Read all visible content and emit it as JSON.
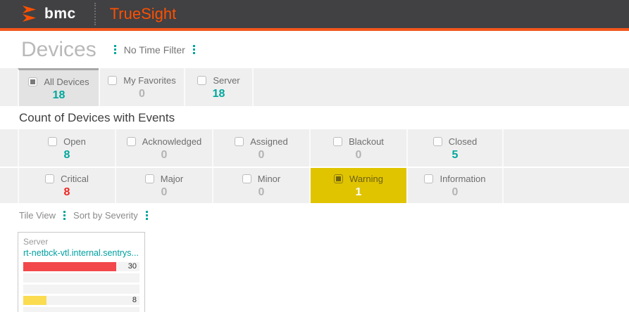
{
  "header": {
    "brand": "bmc",
    "product": "TrueSight"
  },
  "page": {
    "title": "Devices",
    "time_filter_label": "No Time Filter"
  },
  "device_tabs": [
    {
      "label": "All Devices",
      "count": "18",
      "selected": true,
      "count_style": "accent"
    },
    {
      "label": "My Favorites",
      "count": "0",
      "selected": false,
      "count_style": "zero"
    },
    {
      "label": "Server",
      "count": "18",
      "selected": false,
      "count_style": "accent"
    }
  ],
  "events": {
    "heading": "Count of Devices with Events",
    "status_filters": [
      {
        "label": "Open",
        "count": "8",
        "count_style": "accent"
      },
      {
        "label": "Acknowledged",
        "count": "0",
        "count_style": "zero"
      },
      {
        "label": "Assigned",
        "count": "0",
        "count_style": "zero"
      },
      {
        "label": "Blackout",
        "count": "0",
        "count_style": "zero"
      },
      {
        "label": "Closed",
        "count": "5",
        "count_style": "accent"
      }
    ],
    "severity_filters": [
      {
        "label": "Critical",
        "count": "8",
        "count_style": "critical",
        "selected": false
      },
      {
        "label": "Major",
        "count": "0",
        "count_style": "zero",
        "selected": false
      },
      {
        "label": "Minor",
        "count": "0",
        "count_style": "zero",
        "selected": false
      },
      {
        "label": "Warning",
        "count": "1",
        "count_style": "on-gold",
        "selected": true
      },
      {
        "label": "Information",
        "count": "0",
        "count_style": "zero",
        "selected": false
      }
    ]
  },
  "toolbar": {
    "view_mode": "Tile View",
    "sort_mode": "Sort by Severity"
  },
  "tile": {
    "type_label": "Server",
    "device_name": "rt-netbck-vtl.internal.sentrys...",
    "severity_bars": [
      {
        "severity": "critical",
        "value": "30",
        "pct": 80,
        "color": "#f2484b"
      },
      {
        "severity": "major",
        "value": "",
        "pct": 0,
        "color": ""
      },
      {
        "severity": "minor",
        "value": "",
        "pct": 0,
        "color": ""
      },
      {
        "severity": "warning",
        "value": "8",
        "pct": 20,
        "color": "#fbdc51"
      },
      {
        "severity": "information",
        "value": "",
        "pct": 0,
        "color": ""
      }
    ]
  },
  "colors": {
    "accent_teal": "#00a79c",
    "brand_orange": "#fe5000",
    "header_dark": "#414043",
    "critical_red": "#ee2722",
    "warning_gold": "#e0c400",
    "bar_red": "#f2484b",
    "bar_yellow": "#fbdc51"
  }
}
